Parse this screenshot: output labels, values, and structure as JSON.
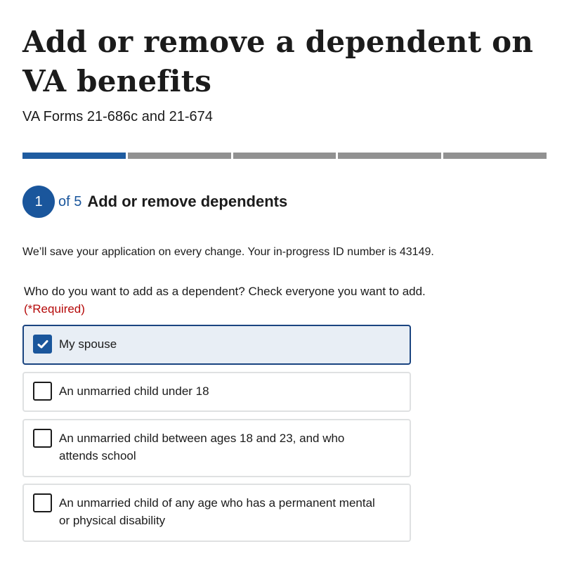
{
  "header": {
    "title": "Add or remove a dependent on VA benefits",
    "subtitle": "VA Forms 21-686c and 21-674"
  },
  "progress": {
    "current_step": 1,
    "total_steps": 5
  },
  "step": {
    "number": "1",
    "of_text": "of 5",
    "title": "Add or remove dependents"
  },
  "save_note": "We’ll save your application on every change. Your in-progress ID number is 43149.",
  "question": {
    "text": "Who do you want to add as a dependent? Check everyone you want to add.",
    "required": "(*Required)"
  },
  "options": [
    {
      "label": "My spouse",
      "checked": true
    },
    {
      "label": "An unmarried child under 18",
      "checked": false
    },
    {
      "label": "An unmarried child between ages 18 and 23, and who attends school",
      "checked": false
    },
    {
      "label": "An unmarried child of any age who has a permanent mental or physical disability",
      "checked": false
    }
  ],
  "colors": {
    "accent": "#1a569c",
    "progress_inactive": "#919191",
    "required": "#b50909",
    "checked_bg": "#e8eef5",
    "checked_border": "#1a4480"
  }
}
